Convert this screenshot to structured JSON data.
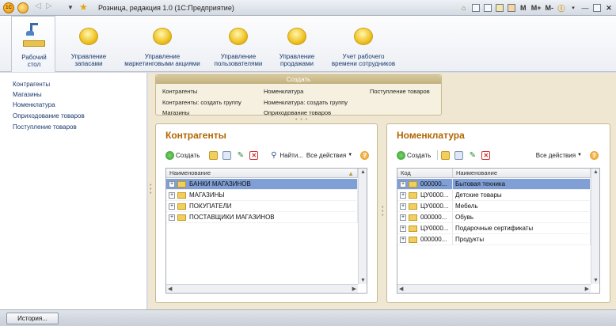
{
  "window": {
    "title": "Розница, редакция 1.0  (1С:Предприятие)",
    "tools": [
      "M",
      "M+",
      "M-"
    ]
  },
  "sections": [
    {
      "label_line1": "Рабочий",
      "label_line2": "стол"
    },
    {
      "label_line1": "Управление",
      "label_line2": "запасами"
    },
    {
      "label_line1": "Управление",
      "label_line2": "маркетинговыми акциями"
    },
    {
      "label_line1": "Управление",
      "label_line2": "пользователями"
    },
    {
      "label_line1": "Управление",
      "label_line2": "продажами"
    },
    {
      "label_line1": "Учет рабочего",
      "label_line2": "времени сотрудников"
    }
  ],
  "leftnav": {
    "items": [
      "Контрагенты",
      "Магазины",
      "Номенклатура",
      "Оприходование товаров",
      "Поступление товаров"
    ]
  },
  "create": {
    "title": "Создать",
    "items": [
      "Контрагенты",
      "Контрагенты: создать группу",
      "Магазины",
      "Номенклатура",
      "Номенклатура: создать группу",
      "Оприходование товаров",
      "Поступление товаров"
    ]
  },
  "contractors": {
    "title": "Контрагенты",
    "create_label": "Создать",
    "find_label": "Найти...",
    "all_actions_label": "Все действия",
    "col_name": "Наименование",
    "rows": [
      "БАНКИ МАГАЗИНОВ",
      "МАГАЗИНЫ",
      "ПОКУПАТЕЛИ",
      "ПОСТАВЩИКИ МАГАЗИНОВ"
    ]
  },
  "nomenclature": {
    "title": "Номенклатура",
    "create_label": "Создать",
    "all_actions_label": "Все действия",
    "col_code": "Код",
    "col_name": "Наименование",
    "rows": [
      {
        "code": "000000...",
        "name": "Бытовая техника"
      },
      {
        "code": "ЦУ0000...",
        "name": "Детские товары"
      },
      {
        "code": "ЦУ0000...",
        "name": "Мебель"
      },
      {
        "code": "000000...",
        "name": "Обувь"
      },
      {
        "code": "ЦУ0000...",
        "name": "Подарочные сертификаты"
      },
      {
        "code": "000000...",
        "name": "Продукты"
      }
    ]
  },
  "bottom": {
    "history_label": "История..."
  }
}
